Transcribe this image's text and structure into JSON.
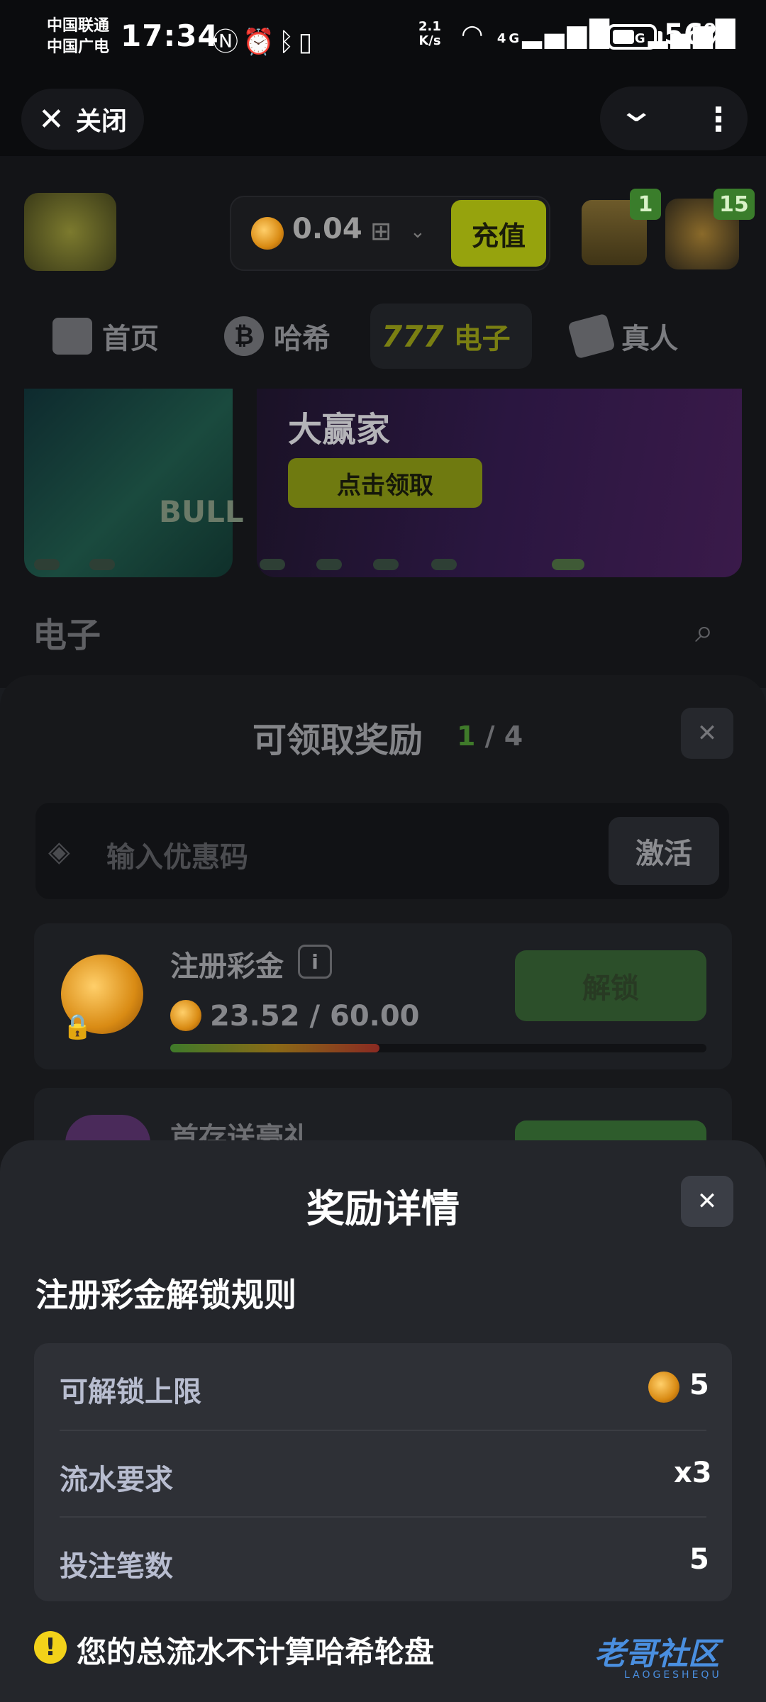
{
  "status_bar": {
    "carrier1": "中国联通",
    "carrier2": "中国广电",
    "time": "17:34",
    "net_speed_value": "2.1",
    "net_speed_unit": "K/s",
    "signal1": "4G",
    "signal2": "5G",
    "battery": "56%"
  },
  "topbar": {
    "close_label": "关闭"
  },
  "header": {
    "balance": "0.04",
    "recharge_label": "充值",
    "chest_badge": "1",
    "avatar_badge": "15"
  },
  "nav": {
    "items": [
      {
        "label": "首页"
      },
      {
        "label": "哈希"
      },
      {
        "label": "电子"
      },
      {
        "label": "真人"
      }
    ]
  },
  "banner": {
    "left_text": "BULL FIGHT",
    "title": "大赢家",
    "button": "点击领取"
  },
  "section": {
    "title": "电子"
  },
  "rewards_sheet": {
    "title": "可领取奖励",
    "count_current": "1",
    "count_sep": " / ",
    "count_total": "4",
    "promo_placeholder": "输入优惠码",
    "activate_label": "激活",
    "cards": [
      {
        "title": "注册彩金",
        "progress_text": "23.52 / 60.00",
        "progress_fraction": 0.39,
        "button": "解锁"
      },
      {
        "title": "首存送豪礼"
      }
    ]
  },
  "detail_sheet": {
    "title": "奖励详情",
    "subtitle": "注册彩金解锁规则",
    "rows": [
      {
        "label": "可解锁上限",
        "value": "5"
      },
      {
        "label": "流水要求",
        "value": "x3"
      },
      {
        "label": "投注笔数",
        "value": "5"
      }
    ],
    "notice": "您的总流水不计算哈希轮盘"
  },
  "watermark": {
    "text": "老哥社区",
    "sub": "LAOGESHEQU"
  },
  "colors": {
    "accent_green": "#3f7a2a",
    "recharge_yellow": "#96a30d",
    "warning_yellow": "#f2d21a"
  }
}
